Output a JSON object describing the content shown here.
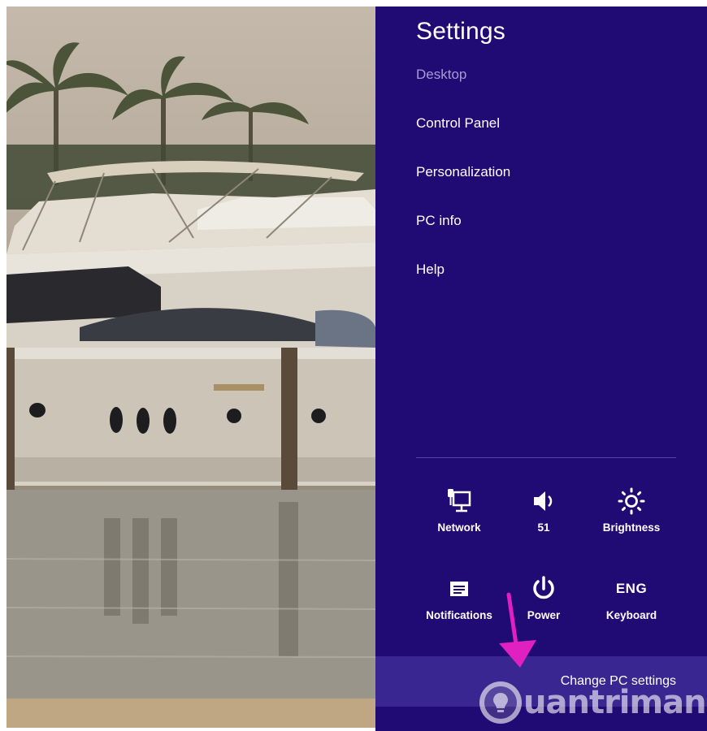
{
  "settings": {
    "title": "Settings",
    "context": "Desktop",
    "links": [
      {
        "label": "Control Panel"
      },
      {
        "label": "Personalization"
      },
      {
        "label": "PC info"
      },
      {
        "label": "Help"
      }
    ],
    "quick": {
      "network": {
        "label": "Network",
        "icon": "network-icon"
      },
      "volume": {
        "label": "51",
        "icon": "speaker-icon"
      },
      "brightness": {
        "label": "Brightness",
        "icon": "sun-icon"
      },
      "notifications": {
        "label": "Notifications",
        "icon": "notifications-icon"
      },
      "power": {
        "label": "Power",
        "icon": "power-icon"
      },
      "keyboard": {
        "label": "Keyboard",
        "icon_text": "ENG"
      }
    },
    "change_pc_settings": "Change PC settings"
  },
  "watermark": {
    "text": "uantrimang"
  },
  "colors": {
    "charm_bg": "#200a73",
    "change_bar_bg": "#3a2690",
    "context_text": "#a89ad8",
    "arrow": "#e020c0"
  }
}
